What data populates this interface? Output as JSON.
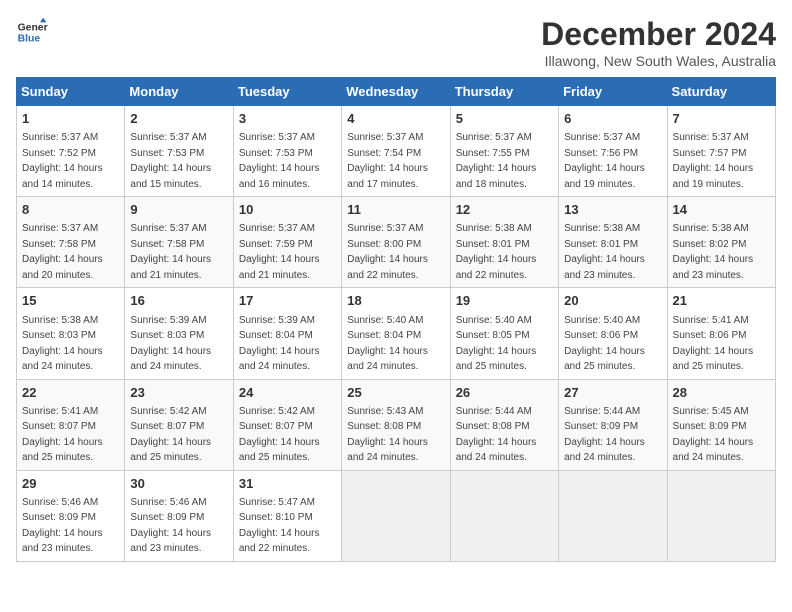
{
  "logo": {
    "line1": "General",
    "line2": "Blue"
  },
  "title": "December 2024",
  "location": "Illawong, New South Wales, Australia",
  "weekdays": [
    "Sunday",
    "Monday",
    "Tuesday",
    "Wednesday",
    "Thursday",
    "Friday",
    "Saturday"
  ],
  "weeks": [
    [
      {
        "day": "1",
        "sunrise": "5:37 AM",
        "sunset": "7:52 PM",
        "daylight": "14 hours and 14 minutes."
      },
      {
        "day": "2",
        "sunrise": "5:37 AM",
        "sunset": "7:53 PM",
        "daylight": "14 hours and 15 minutes."
      },
      {
        "day": "3",
        "sunrise": "5:37 AM",
        "sunset": "7:53 PM",
        "daylight": "14 hours and 16 minutes."
      },
      {
        "day": "4",
        "sunrise": "5:37 AM",
        "sunset": "7:54 PM",
        "daylight": "14 hours and 17 minutes."
      },
      {
        "day": "5",
        "sunrise": "5:37 AM",
        "sunset": "7:55 PM",
        "daylight": "14 hours and 18 minutes."
      },
      {
        "day": "6",
        "sunrise": "5:37 AM",
        "sunset": "7:56 PM",
        "daylight": "14 hours and 19 minutes."
      },
      {
        "day": "7",
        "sunrise": "5:37 AM",
        "sunset": "7:57 PM",
        "daylight": "14 hours and 19 minutes."
      }
    ],
    [
      {
        "day": "8",
        "sunrise": "5:37 AM",
        "sunset": "7:58 PM",
        "daylight": "14 hours and 20 minutes."
      },
      {
        "day": "9",
        "sunrise": "5:37 AM",
        "sunset": "7:58 PM",
        "daylight": "14 hours and 21 minutes."
      },
      {
        "day": "10",
        "sunrise": "5:37 AM",
        "sunset": "7:59 PM",
        "daylight": "14 hours and 21 minutes."
      },
      {
        "day": "11",
        "sunrise": "5:37 AM",
        "sunset": "8:00 PM",
        "daylight": "14 hours and 22 minutes."
      },
      {
        "day": "12",
        "sunrise": "5:38 AM",
        "sunset": "8:01 PM",
        "daylight": "14 hours and 22 minutes."
      },
      {
        "day": "13",
        "sunrise": "5:38 AM",
        "sunset": "8:01 PM",
        "daylight": "14 hours and 23 minutes."
      },
      {
        "day": "14",
        "sunrise": "5:38 AM",
        "sunset": "8:02 PM",
        "daylight": "14 hours and 23 minutes."
      }
    ],
    [
      {
        "day": "15",
        "sunrise": "5:38 AM",
        "sunset": "8:03 PM",
        "daylight": "14 hours and 24 minutes."
      },
      {
        "day": "16",
        "sunrise": "5:39 AM",
        "sunset": "8:03 PM",
        "daylight": "14 hours and 24 minutes."
      },
      {
        "day": "17",
        "sunrise": "5:39 AM",
        "sunset": "8:04 PM",
        "daylight": "14 hours and 24 minutes."
      },
      {
        "day": "18",
        "sunrise": "5:40 AM",
        "sunset": "8:04 PM",
        "daylight": "14 hours and 24 minutes."
      },
      {
        "day": "19",
        "sunrise": "5:40 AM",
        "sunset": "8:05 PM",
        "daylight": "14 hours and 25 minutes."
      },
      {
        "day": "20",
        "sunrise": "5:40 AM",
        "sunset": "8:06 PM",
        "daylight": "14 hours and 25 minutes."
      },
      {
        "day": "21",
        "sunrise": "5:41 AM",
        "sunset": "8:06 PM",
        "daylight": "14 hours and 25 minutes."
      }
    ],
    [
      {
        "day": "22",
        "sunrise": "5:41 AM",
        "sunset": "8:07 PM",
        "daylight": "14 hours and 25 minutes."
      },
      {
        "day": "23",
        "sunrise": "5:42 AM",
        "sunset": "8:07 PM",
        "daylight": "14 hours and 25 minutes."
      },
      {
        "day": "24",
        "sunrise": "5:42 AM",
        "sunset": "8:07 PM",
        "daylight": "14 hours and 25 minutes."
      },
      {
        "day": "25",
        "sunrise": "5:43 AM",
        "sunset": "8:08 PM",
        "daylight": "14 hours and 24 minutes."
      },
      {
        "day": "26",
        "sunrise": "5:44 AM",
        "sunset": "8:08 PM",
        "daylight": "14 hours and 24 minutes."
      },
      {
        "day": "27",
        "sunrise": "5:44 AM",
        "sunset": "8:09 PM",
        "daylight": "14 hours and 24 minutes."
      },
      {
        "day": "28",
        "sunrise": "5:45 AM",
        "sunset": "8:09 PM",
        "daylight": "14 hours and 24 minutes."
      }
    ],
    [
      {
        "day": "29",
        "sunrise": "5:46 AM",
        "sunset": "8:09 PM",
        "daylight": "14 hours and 23 minutes."
      },
      {
        "day": "30",
        "sunrise": "5:46 AM",
        "sunset": "8:09 PM",
        "daylight": "14 hours and 23 minutes."
      },
      {
        "day": "31",
        "sunrise": "5:47 AM",
        "sunset": "8:10 PM",
        "daylight": "14 hours and 22 minutes."
      },
      null,
      null,
      null,
      null
    ]
  ],
  "labels": {
    "sunrise": "Sunrise:",
    "sunset": "Sunset:",
    "daylight": "Daylight:"
  }
}
